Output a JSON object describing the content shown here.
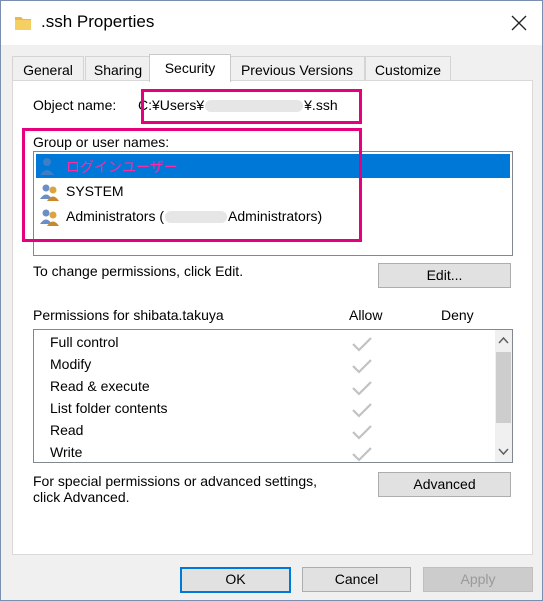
{
  "window": {
    "title": ".ssh Properties"
  },
  "tabs": [
    {
      "label": "General"
    },
    {
      "label": "Sharing"
    },
    {
      "label": "Security"
    },
    {
      "label": "Previous Versions"
    },
    {
      "label": "Customize"
    }
  ],
  "security": {
    "object_name_label": "Object name:",
    "object_path_prefix": "C:¥Users¥",
    "object_path_suffix": "¥.ssh",
    "group_label": "Group or user names:",
    "principals": [
      {
        "name": "ログインユーザー",
        "selected": true
      },
      {
        "name": "SYSTEM",
        "selected": false
      },
      {
        "name_prefix": "Administrators (",
        "name_suffix": "Administrators)",
        "selected": false
      }
    ],
    "change_text": "To change permissions, click Edit.",
    "edit_label": "Edit...",
    "permissions_for": "Permissions for shibata.takuya",
    "allow_header": "Allow",
    "deny_header": "Deny",
    "permissions": [
      {
        "name": "Full control"
      },
      {
        "name": "Modify"
      },
      {
        "name": "Read & execute"
      },
      {
        "name": "List folder contents"
      },
      {
        "name": "Read"
      },
      {
        "name": "Write"
      }
    ],
    "special_text_line1": "For special permissions or advanced settings,",
    "special_text_line2": "click Advanced.",
    "advanced_label": "Advanced"
  },
  "footer": {
    "ok_label": "OK",
    "cancel_label": "Cancel",
    "apply_label": "Apply"
  },
  "colors": {
    "highlight_box": "#e6007e",
    "selection": "#0078d7",
    "annotation_text": "#ff2aa3"
  }
}
